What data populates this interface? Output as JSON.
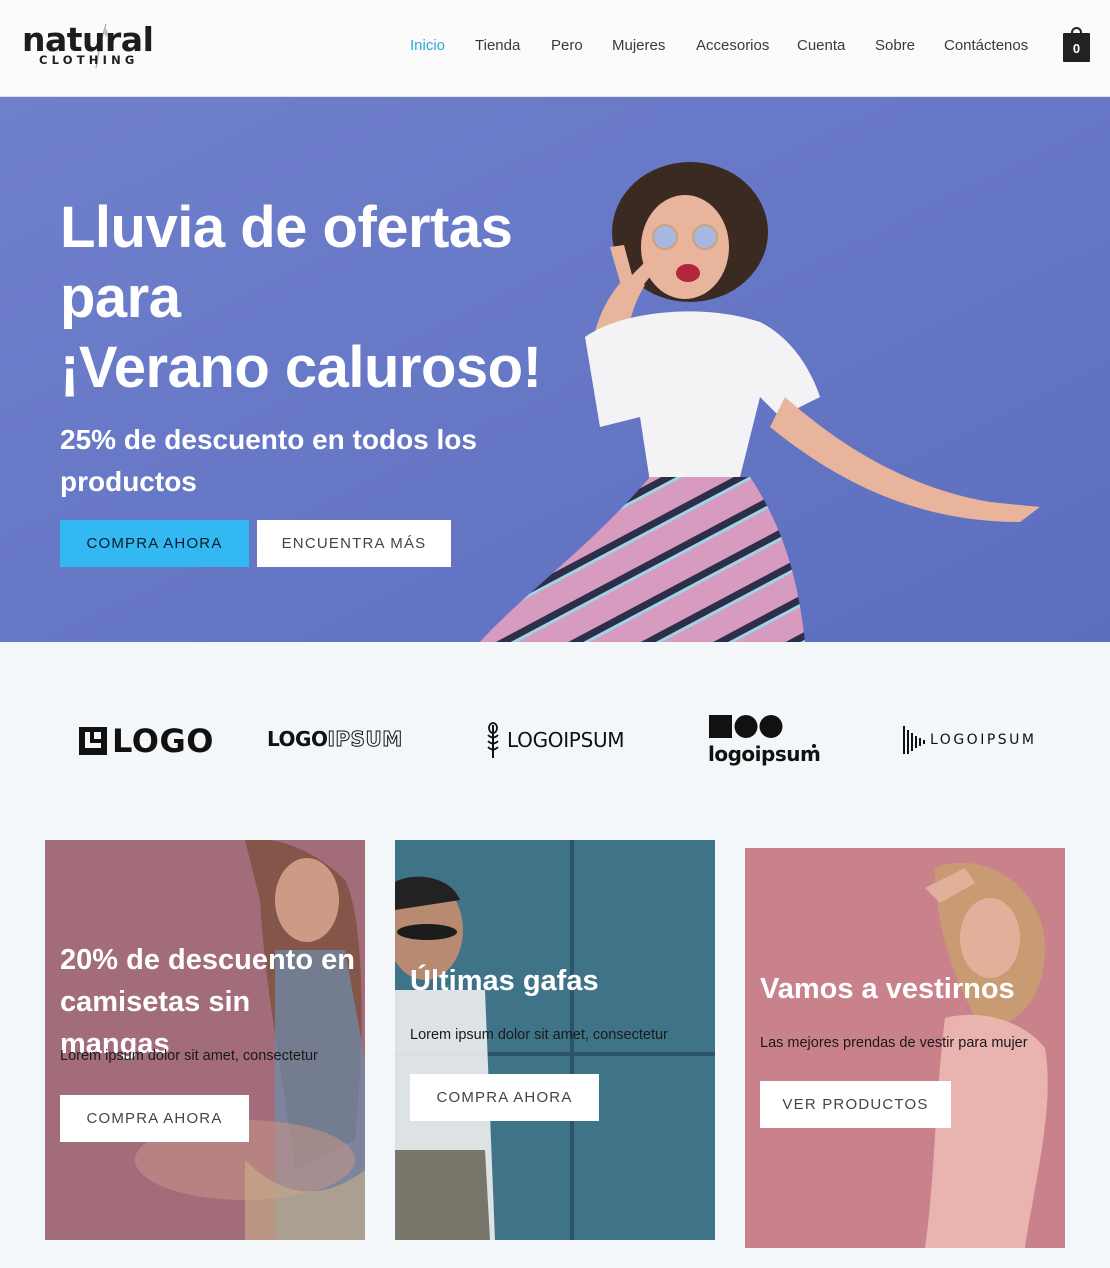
{
  "header": {
    "logo_main": "natural",
    "logo_sub": "CLOTHING",
    "nav": [
      {
        "label": "Inicio",
        "active": true
      },
      {
        "label": "Tienda",
        "active": false
      },
      {
        "label": "Pero",
        "active": false
      },
      {
        "label": "Mujeres",
        "active": false
      },
      {
        "label": "Accesorios",
        "active": false
      },
      {
        "label": "Cuenta",
        "active": false
      },
      {
        "label": "Sobre",
        "active": false
      },
      {
        "label": "Contáctenos",
        "active": false
      }
    ],
    "cart_count": "0",
    "accent_color": "#29a8e0"
  },
  "hero": {
    "title_lines": [
      "Lluvia de ofertas",
      "para",
      "¡Verano caluroso!"
    ],
    "subtitle": "25% de descuento en todos los productos",
    "primary_button": "COMPRA AHORA",
    "secondary_button": "ENCUENTRA MÁS",
    "background_color": "#6878c6",
    "primary_button_color": "#34b8f2"
  },
  "brands": [
    {
      "name": "LOGO"
    },
    {
      "name_bold": "LOGO",
      "name_outline": "IPSUM"
    },
    {
      "name": "LOGOIPSUM"
    },
    {
      "name": "logoipsum"
    },
    {
      "name": "LOGOIPSUM"
    }
  ],
  "cards": [
    {
      "title": "20% de descuento en camisetas sin mangas",
      "text": "Lorem ipsum dolor sit amet, consectetur",
      "button": "COMPRA AHORA",
      "color": "#a26c7a"
    },
    {
      "title": "Últimas gafas",
      "text": "Lorem ipsum dolor sit amet, consectetur",
      "button": "COMPRA AHORA",
      "color": "#3f7388"
    },
    {
      "title": "Vamos a vestirnos",
      "text": "Las mejores prendas de vestir para mujer",
      "button": "VER PRODUCTOS",
      "color": "#c9828b"
    }
  ]
}
